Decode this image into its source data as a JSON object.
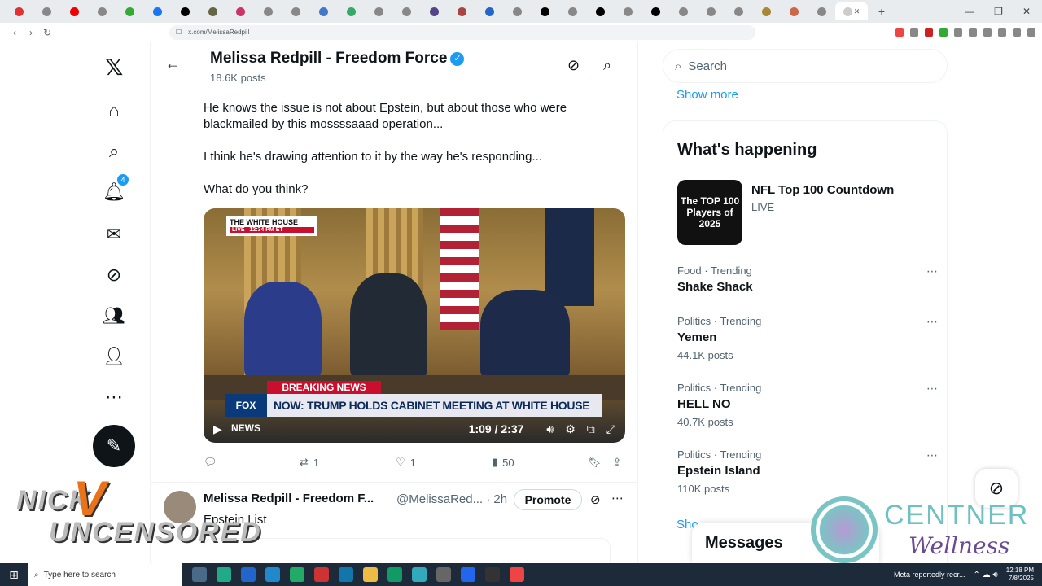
{
  "browser": {
    "url": "x.com/MelissaRedpill",
    "tab_count_icons": 33
  },
  "nav": {
    "notifications_badge": "4"
  },
  "profile": {
    "name": "Melissa Redpill - Freedom Force",
    "posts": "18.6K posts"
  },
  "post": {
    "line1": "He knows the issue is not about Epstein, but about those who were",
    "line2": "blackmailed by this mossssaaad operation...",
    "line3": "I think he's drawing attention to it by the way he's responding...",
    "line4": "What do you think?",
    "video": {
      "badge_title": "THE WHITE HOUSE",
      "badge_live": "LIVE | 12:34 PM ET",
      "breaking": "BREAKING NEWS",
      "fox": "FOX NEWS",
      "headline": "NOW: TRUMP HOLDS CABINET MEETING AT WHITE HOUSE",
      "time": "1:09 / 2:37"
    },
    "replies": "",
    "reposts": "1",
    "likes": "1",
    "views": "50"
  },
  "post2": {
    "name": "Melissa Redpill - Freedom F...",
    "handle": "@MelissaRed... · 2h",
    "promote": "Promote",
    "text": "Epstein List"
  },
  "sidebar": {
    "search_placeholder": "Search",
    "show_more": "Show more",
    "trends_title": "What's happening",
    "featured": {
      "image_text": "The TOP 100 Players of 2025",
      "title": "NFL Top 100 Countdown",
      "status": "LIVE"
    },
    "trends": [
      {
        "meta": "Food · Trending",
        "name": "Shake Shack",
        "count": ""
      },
      {
        "meta": "Politics · Trending",
        "name": "Yemen",
        "count": "44.1K posts"
      },
      {
        "meta": "Politics · Trending",
        "name": "HELL NO",
        "count": "40.7K posts"
      },
      {
        "meta": "Politics · Trending",
        "name": "Epstein Island",
        "count": "110K posts"
      }
    ],
    "show_more_2": "Sho"
  },
  "messages": {
    "label": "Messages"
  },
  "overlays": {
    "nick_pre": "NICK",
    "nick_v": "V",
    "nick_post": "UNCENSORED",
    "centner": "CENTNER",
    "wellness": "Wellness"
  },
  "taskbar": {
    "search_placeholder": "Type here to search",
    "news": "Meta reportedly recr...",
    "time": "12:18 PM",
    "date": "7/8/2025"
  }
}
